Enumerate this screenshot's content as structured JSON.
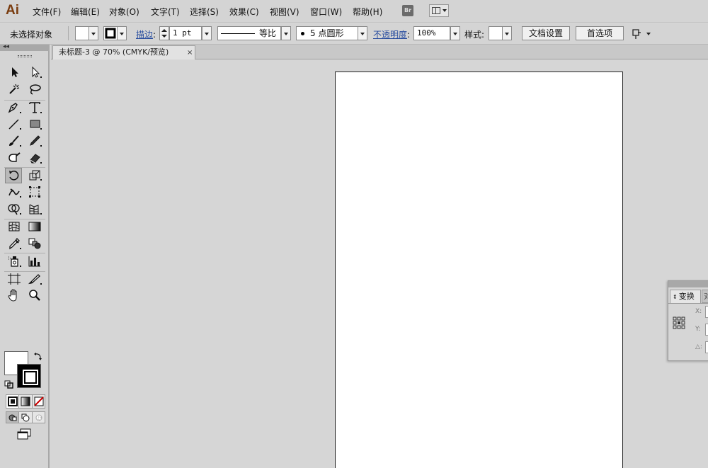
{
  "app": {
    "logo": "Ai"
  },
  "menu": [
    "文件(F)",
    "编辑(E)",
    "对象(O)",
    "文字(T)",
    "选择(S)",
    "效果(C)",
    "视图(V)",
    "窗口(W)",
    "帮助(H)"
  ],
  "menu_extras": {
    "bridge": "Br"
  },
  "control": {
    "selection_status": "未选择对象",
    "stroke_label": "描边",
    "stroke_weight": "1 pt",
    "profile_label": "等比",
    "brush_label": "5 点圆形",
    "opacity_label": "不透明度",
    "opacity_value": "100%",
    "style_label": "样式",
    "document_setup": "文档设置",
    "preferences": "首选项"
  },
  "document_tab": {
    "title": "未标题-3 @ 70% (CMYK/预览)",
    "close": "×"
  },
  "toolbox": {
    "collapse": "◂◂",
    "tools": [
      "selection",
      "direct-selection",
      "magic-wand",
      "lasso",
      "pen",
      "type",
      "line-segment",
      "rectangle",
      "paintbrush",
      "pencil",
      "blob-brush",
      "eraser",
      "rotate",
      "scale",
      "warp",
      "free-transform",
      "shape-builder",
      "perspective-grid",
      "mesh",
      "gradient",
      "eyedropper",
      "blend",
      "symbol-sprayer",
      "column-graph",
      "artboard",
      "slice",
      "hand",
      "zoom"
    ],
    "active_tool": "rotate"
  },
  "transform_panel": {
    "tab": "变换",
    "second_tab": "对",
    "labels": [
      "X:",
      "Y:",
      "△:"
    ]
  },
  "colors": {
    "accent": "#2b4fa0",
    "logo": "#7a3c0f",
    "background": "#d6d6d6"
  }
}
